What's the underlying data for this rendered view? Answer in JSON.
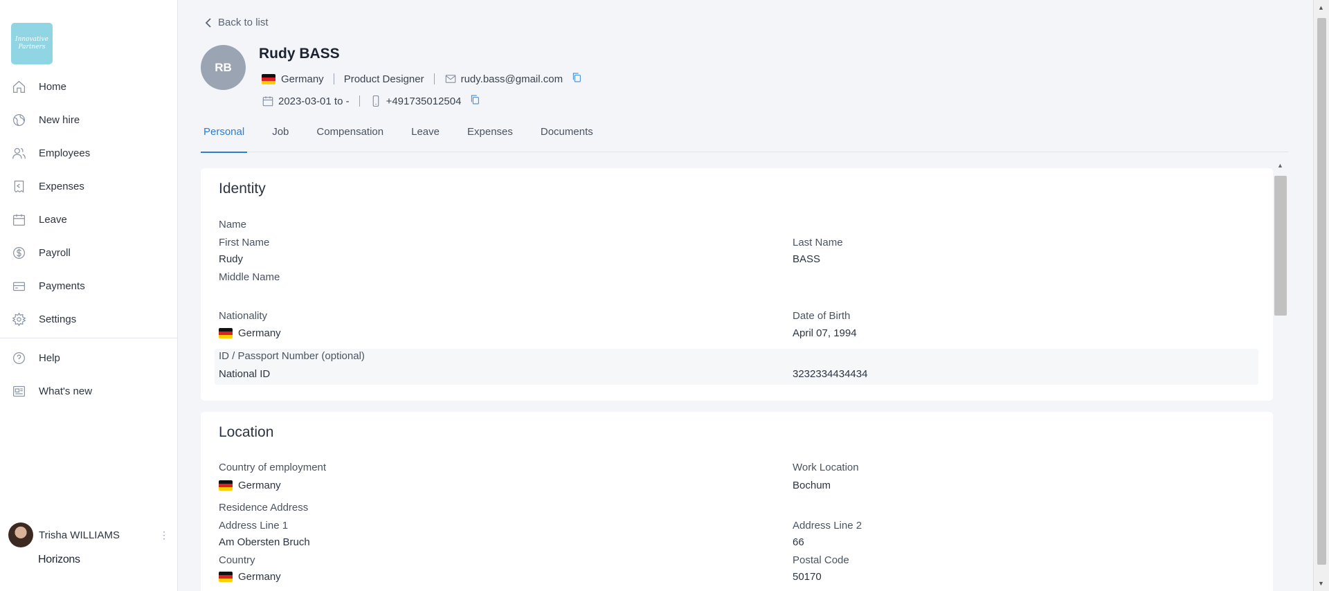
{
  "sidebar": {
    "logo_line1": "Innovative",
    "logo_line2": "Partners",
    "items": [
      {
        "label": "Home",
        "icon": "home-icon"
      },
      {
        "label": "New hire",
        "icon": "globe-icon"
      },
      {
        "label": "Employees",
        "icon": "users-icon"
      },
      {
        "label": "Expenses",
        "icon": "receipt-icon"
      },
      {
        "label": "Leave",
        "icon": "calendar-icon"
      },
      {
        "label": "Payroll",
        "icon": "dollar-icon"
      },
      {
        "label": "Payments",
        "icon": "card-icon"
      },
      {
        "label": "Settings",
        "icon": "gear-icon"
      }
    ],
    "secondary": [
      {
        "label": "Help",
        "icon": "help-icon"
      },
      {
        "label": "What's new",
        "icon": "news-icon"
      }
    ],
    "user_name": "Trisha WILLIAMS",
    "brand": "Horizons"
  },
  "header": {
    "back_label": "Back to list",
    "initials": "RB",
    "name": "Rudy BASS",
    "country": "Germany",
    "job_title": "Product Designer",
    "email": "rudy.bass@gmail.com",
    "dates": "2023-03-01 to -",
    "phone": "+491735012504"
  },
  "tabs": [
    "Personal",
    "Job",
    "Compensation",
    "Leave",
    "Expenses",
    "Documents"
  ],
  "identity": {
    "title": "Identity",
    "name_label": "Name",
    "first_name_label": "First Name",
    "first_name": "Rudy",
    "last_name_label": "Last Name",
    "last_name": "BASS",
    "middle_name_label": "Middle Name",
    "nationality_label": "Nationality",
    "nationality": "Germany",
    "dob_label": "Date of Birth",
    "dob": "April 07, 1994",
    "id_label": "ID / Passport Number (optional)",
    "id_type": "National ID",
    "id_number": "3232334434434"
  },
  "location": {
    "title": "Location",
    "country_label": "Country of employment",
    "country": "Germany",
    "work_location_label": "Work Location",
    "work_location": "Bochum",
    "residence_label": "Residence Address",
    "addr1_label": "Address Line 1",
    "addr1": "Am Obersten Bruch",
    "addr2_label": "Address Line 2",
    "addr2": "66",
    "res_country_label": "Country",
    "res_country": "Germany",
    "postal_label": "Postal Code",
    "postal": "50170"
  }
}
